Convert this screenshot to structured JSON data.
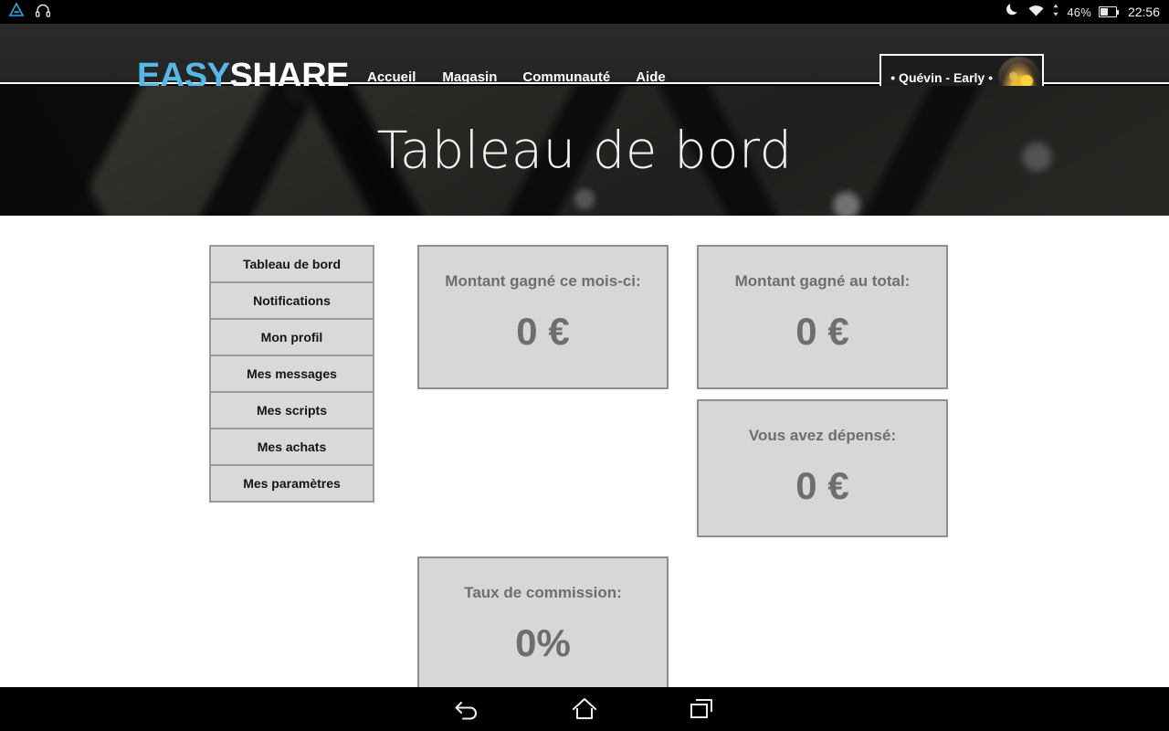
{
  "status_bar": {
    "left_icons": [
      "signal-app-icon",
      "headphones-icon"
    ],
    "right_icons": [
      "moon-do-not-disturb-icon",
      "wifi-icon",
      "data-transfer-icon",
      "battery-icon"
    ],
    "battery_percent": "46%",
    "battery_level": 46,
    "clock": "22:56"
  },
  "header": {
    "brand_first": "EASY",
    "brand_second": "SHARE",
    "brand_accent_color": "#54b9e8",
    "nav": [
      {
        "label": "Accueil"
      },
      {
        "label": "Magasin"
      },
      {
        "label": "Communauté"
      },
      {
        "label": "Aide"
      }
    ],
    "user": {
      "name": "• Quévin - Early •",
      "avatar_icon": "user-avatar-image"
    }
  },
  "hero": {
    "title": "Tableau de bord",
    "background": "keyboard-photo"
  },
  "sidebar": {
    "items": [
      {
        "label": "Tableau de bord"
      },
      {
        "label": "Notifications"
      },
      {
        "label": "Mon profil"
      },
      {
        "label": "Mes messages"
      },
      {
        "label": "Mes scripts"
      },
      {
        "label": "Mes achats"
      },
      {
        "label": "Mes paramètres"
      }
    ]
  },
  "cards": {
    "month_earnings": {
      "label": "Montant gagné ce mois-ci:",
      "value": "0 €"
    },
    "total_earnings": {
      "label": "Montant gagné au total:",
      "value": "0 €"
    },
    "spent": {
      "label": "Vous avez dépensé:",
      "value": "0 €"
    },
    "commission": {
      "label": "Taux de commission:",
      "value": "0%"
    }
  },
  "nav_bar": {
    "buttons": [
      {
        "name": "back-icon"
      },
      {
        "name": "home-icon"
      },
      {
        "name": "recents-icon"
      }
    ]
  }
}
